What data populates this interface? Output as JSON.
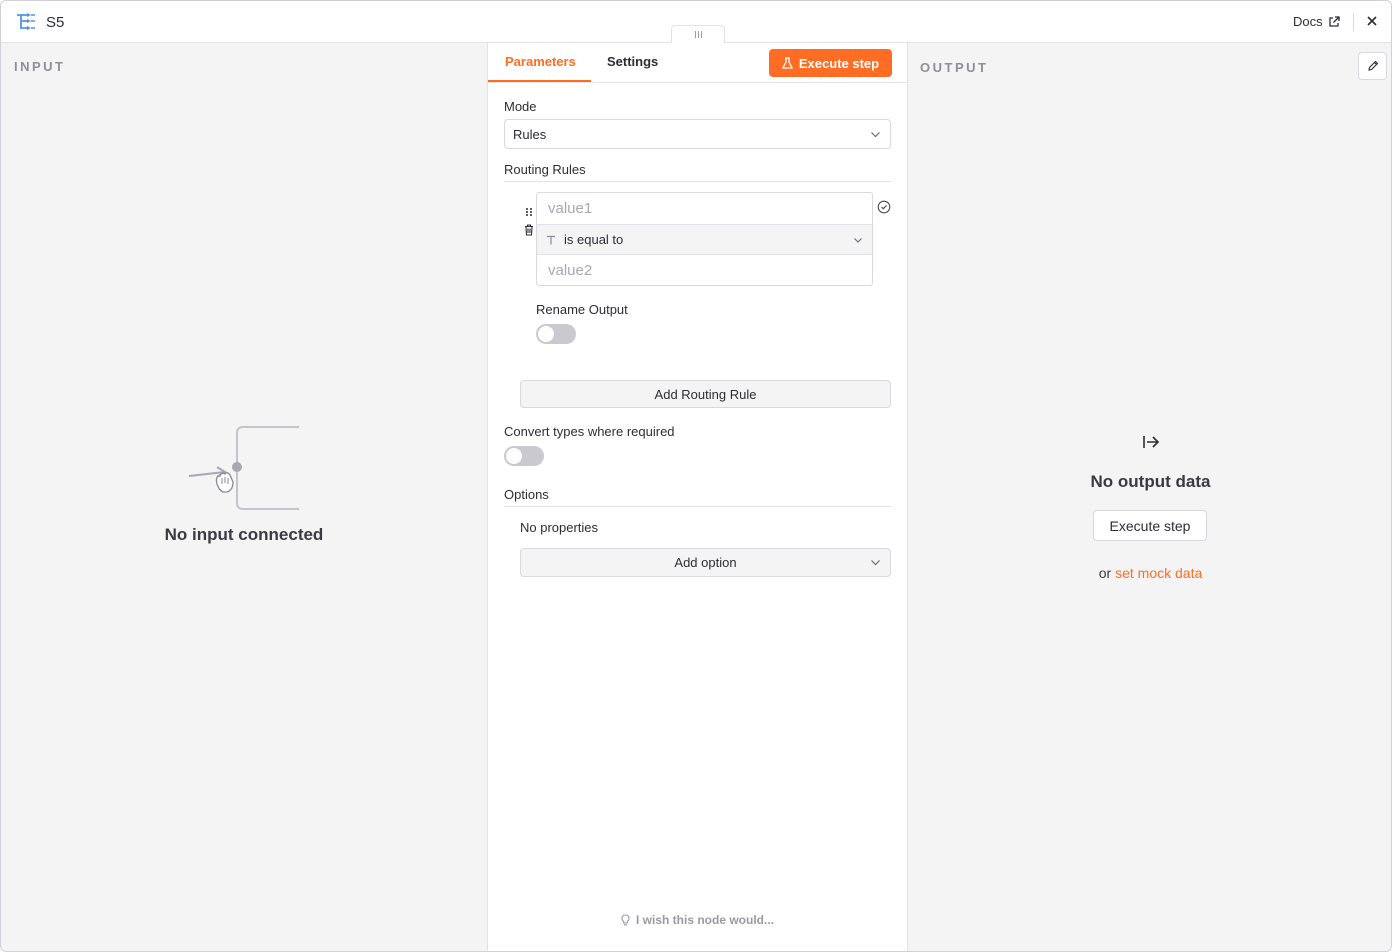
{
  "header": {
    "node_name": "S5",
    "docs_label": "Docs"
  },
  "input_panel": {
    "section_label": "INPUT",
    "empty_title": "No input connected"
  },
  "main": {
    "tabs": [
      {
        "label": "Parameters",
        "active": true
      },
      {
        "label": "Settings",
        "active": false
      }
    ],
    "execute_label": "Execute step",
    "mode": {
      "label": "Mode",
      "value": "Rules"
    },
    "routing_rules": {
      "title": "Routing Rules",
      "rule": {
        "value1_placeholder": "value1",
        "operator": "is equal to",
        "value2_placeholder": "value2"
      },
      "rename_output_label": "Rename Output",
      "rename_output_enabled": false,
      "add_label": "Add Routing Rule"
    },
    "convert_types": {
      "label": "Convert types where required",
      "enabled": false
    },
    "options": {
      "title": "Options",
      "empty_text": "No properties",
      "add_label": "Add option"
    },
    "feedback_hint": "I wish this node would..."
  },
  "output_panel": {
    "section_label": "OUTPUT",
    "empty_title": "No output data",
    "execute_label": "Execute step",
    "mock_prefix": "or",
    "mock_link": "set mock data"
  },
  "colors": {
    "accent": "#ff6d24",
    "panel_bg": "#f4f4f4",
    "node_icon": "#4c96e8"
  }
}
